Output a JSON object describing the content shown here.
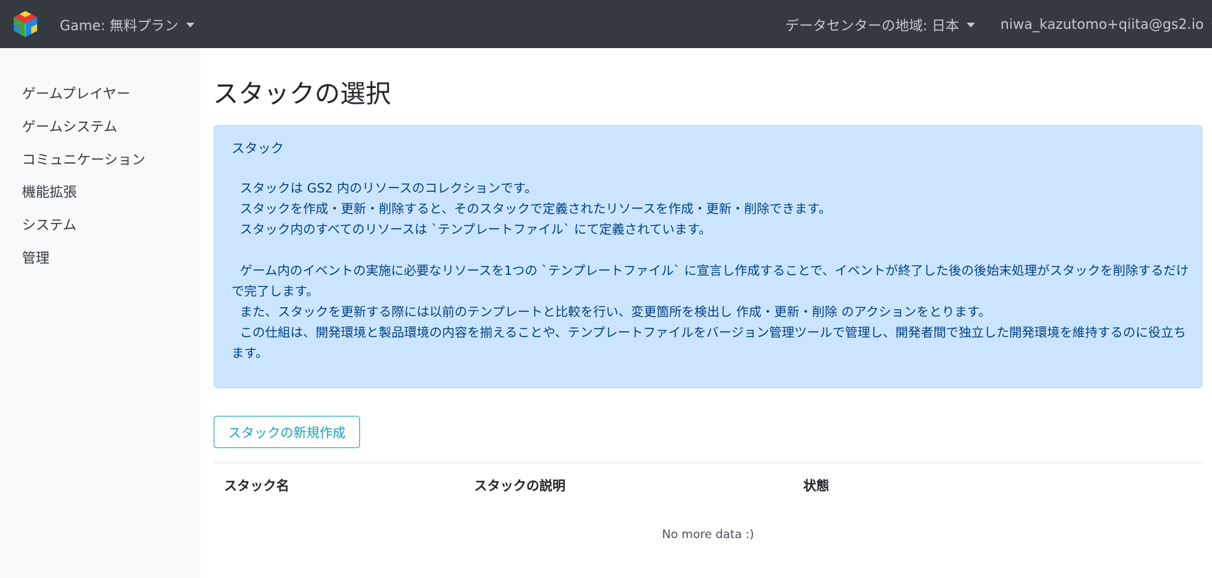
{
  "navbar": {
    "bg_color": "#343a40",
    "logo_icon": "cube-logo-icon",
    "game_label": "Game: 無料プラン",
    "region_label": "データセンターの地域: 日本",
    "user_label": "niwa_kazutomo+qiita@gs2.io"
  },
  "sidebar": {
    "items": [
      {
        "label": "ゲームプレイヤー"
      },
      {
        "label": "ゲームシステム"
      },
      {
        "label": "コミュニケーション"
      },
      {
        "label": "機能拡張"
      },
      {
        "label": "システム"
      },
      {
        "label": "管理"
      }
    ]
  },
  "main": {
    "title": "スタックの選択",
    "info": {
      "title": "スタック",
      "paragraph1": [
        "スタックは GS2 内のリソースのコレクションです。",
        "スタックを作成・更新・削除すると、そのスタックで定義されたリソースを作成・更新・削除できます。",
        "スタック内のすべてのリソースは `テンプレートファイル` にて定義されています。"
      ],
      "paragraph2": [
        "ゲーム内のイベントの実施に必要なリソースを1つの `テンプレートファイル` に宣言し作成することで、イベントが終了した後の後始末処理がスタックを削除するだけで完了します。",
        "また、スタックを更新する際には以前のテンプレートと比較を行い、変更箇所を検出し 作成・更新・削除 のアクションをとります。",
        "この仕組は、開発環境と製品環境の内容を揃えることや、テンプレートファイルをバージョン管理ツールで管理し、開発者間で独立した開発環境を維持するのに役立ちます。"
      ],
      "bg_color": "#cce5ff",
      "text_color": "#004085"
    },
    "new_button_label": "スタックの新規作成",
    "accent_color": "#17a2b8",
    "table": {
      "headers": [
        "スタック名",
        "スタックの説明",
        "状態"
      ],
      "empty_message": "No more data :)"
    }
  }
}
